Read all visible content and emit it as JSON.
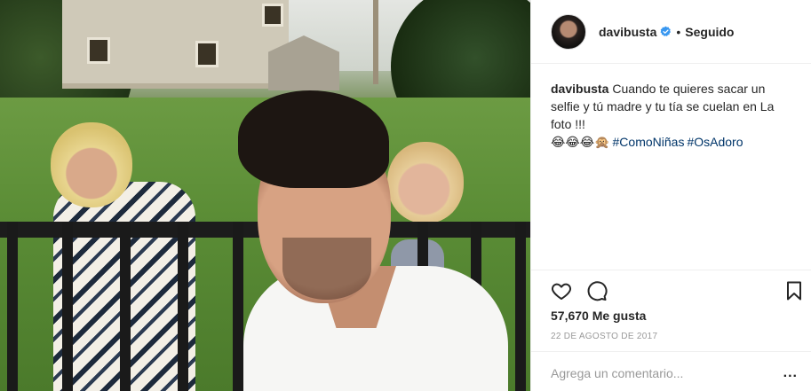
{
  "post": {
    "header": {
      "username": "davibusta",
      "verified_icon": "verified-badge-icon",
      "separator": "•",
      "follow_status": "Seguido"
    },
    "caption": {
      "username": "davibusta",
      "text": "Cuando te quieres sacar un selfie y tú madre y tu tía se cuelan en La foto !!!",
      "emojis": "😂😂😂🙊",
      "hashtags": [
        "#ComoNiñas",
        "#OsAdoro"
      ]
    },
    "actions": {
      "like_icon": "heart-icon",
      "comment_icon": "comment-bubble-icon",
      "save_icon": "bookmark-icon"
    },
    "likes": "57,670 Me gusta",
    "date": "22 DE AGOSTO DE 2017",
    "comment": {
      "placeholder": "Agrega un comentario...",
      "more_label": "..."
    },
    "colors": {
      "text": "#262626",
      "hashtag": "#003569",
      "muted": "#999999",
      "verified": "#3897f0",
      "divider": "#efefef"
    }
  }
}
